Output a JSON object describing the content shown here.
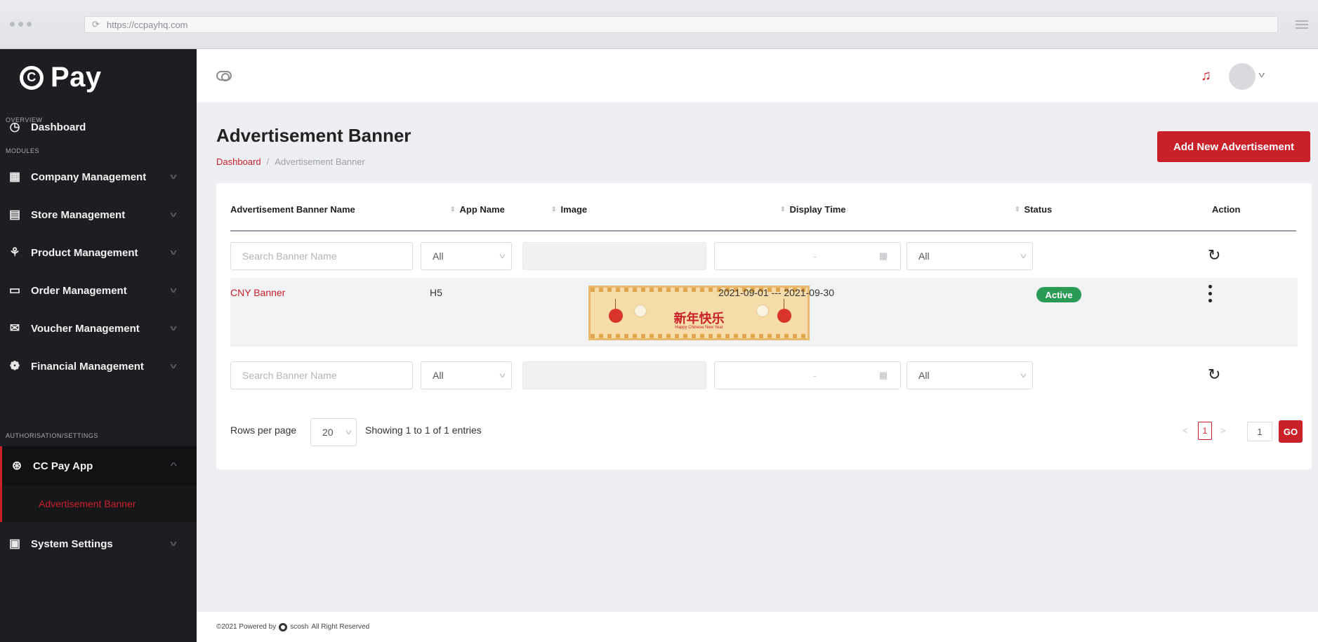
{
  "browser": {
    "url": "https://ccpayhq.com"
  },
  "sidebar": {
    "logo_mark": "C",
    "logo_text": "Pay",
    "sections": {
      "overview": "OVERVIEW",
      "modules": "MODULES",
      "settings": "AUTHORISATION/SETTINGS"
    },
    "items": [
      {
        "label": "Dashboard",
        "icon": "speedometer-icon"
      },
      {
        "label": "Company Management",
        "icon": "building-icon"
      },
      {
        "label": "Store Management",
        "icon": "store-icon"
      },
      {
        "label": "Product Management",
        "icon": "product-icon"
      },
      {
        "label": "Order Management",
        "icon": "order-icon"
      },
      {
        "label": "Voucher Management",
        "icon": "voucher-icon"
      },
      {
        "label": "Financial Management",
        "icon": "finance-icon"
      },
      {
        "label": "CC Pay App",
        "icon": "app-icon"
      },
      {
        "label": "System Settings",
        "icon": "settings-icon"
      }
    ],
    "sub_item": "Advertisement Banner"
  },
  "page": {
    "title": "Advertisement Banner",
    "breadcrumb": {
      "home": "Dashboard",
      "separator": "/",
      "current": "Advertisement Banner"
    },
    "add_button": "Add New Advertisement"
  },
  "table": {
    "columns": [
      "Advertisement Banner Name",
      "App Name",
      "Image",
      "Display Time",
      "Status",
      "Action"
    ],
    "filters": {
      "name_placeholder": "Search Banner Name",
      "app_value": "All",
      "date_separator": "-",
      "status_value": "All"
    },
    "rows": [
      {
        "name": "CNY Banner",
        "app": "H5",
        "image_text": "新年快乐",
        "image_subtext": "Happy Chinese New Year",
        "display_time": "2021-09-01 --- 2021-09-30",
        "status": "Active"
      }
    ],
    "rows_per_page_label": "Rows per page",
    "rows_per_page": "20",
    "showing": "Showing 1 to 1 of 1 entries",
    "current_page": "1",
    "goto_value": "1",
    "go_label": "GO"
  },
  "footer": {
    "prefix": "©2021 Powered by",
    "brand": "scosh",
    "suffix": "All Right Reserved"
  },
  "colors": {
    "accent": "#c9202a",
    "sidebar_bg": "#1d1e22",
    "status_active": "#2a9a55"
  }
}
